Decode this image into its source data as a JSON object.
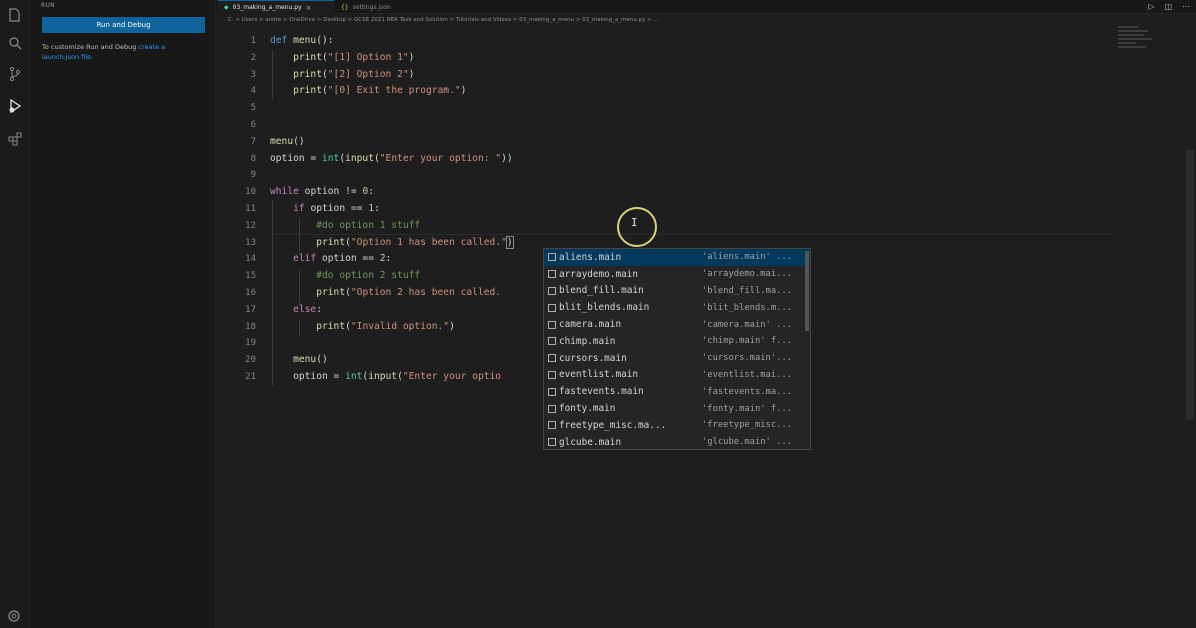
{
  "sidebar": {
    "title": "RUN",
    "run_button": "Run and Debug",
    "hint_text": "To customize Run and Debug",
    "hint_link": "create a launch.json file.",
    "hint_suffix": ""
  },
  "tabs": [
    {
      "label": "03_making_a_menu.py",
      "active": true
    },
    {
      "label": "settings.json",
      "active": false
    }
  ],
  "breadcrumb": "C: > Users > andre > OneDrive > Desktop > GCSE 2021 NEA Task and Solution > Tutorials and Videos > 03_making_a_menu > 03_making_a_menu.py > ...",
  "editor": {
    "line_numbers": [
      "1",
      "2",
      "3",
      "4",
      "5",
      "6",
      "7",
      "8",
      "9",
      "10",
      "11",
      "12",
      "13",
      "14",
      "15",
      "16",
      "17",
      "18",
      "19",
      "20",
      "21"
    ],
    "lines": {
      "l1_kw": "def",
      "l1_fn": "menu",
      "l1_rest": "():",
      "l2_fn": "print",
      "l2_str": "\"[1] Option 1\"",
      "l3_fn": "print",
      "l3_str": "\"[2] Option 2\"",
      "l4_fn": "print",
      "l4_str": "\"[0] Exit the program.\"",
      "l7_fn": "menu",
      "l8_var": "option",
      "l8_bi": "int",
      "l8_fn": "input",
      "l8_str": "\"Enter your option: \"",
      "l10_kw": "while",
      "l10_rest": " option != ",
      "l10_num": "0",
      "l11_kw": "if",
      "l11_rest": " option == ",
      "l11_num": "1",
      "l12_cmt": "#do option 1 stuff",
      "l13_fn": "print",
      "l13_str": "\"Option 1 has been called.\"",
      "l14_kw": "elif",
      "l14_rest": " option == ",
      "l14_num": "2",
      "l15_cmt": "#do option 2 stuff",
      "l16_fn": "print",
      "l16_str": "\"Option 2 has been called.",
      "l17_kw": "else",
      "l18_fn": "print",
      "l18_str": "\"Invalid option.\"",
      "l20_fn": "menu",
      "l21_var": "option",
      "l21_bi": "int",
      "l21_fn": "input",
      "l21_str": "\"Enter your optio"
    }
  },
  "suggestions": [
    {
      "label": "aliens.main",
      "detail": "'aliens.main' ..."
    },
    {
      "label": "arraydemo.main",
      "detail": "'arraydemo.mai..."
    },
    {
      "label": "blend_fill.main",
      "detail": "'blend_fill.ma..."
    },
    {
      "label": "blit_blends.main",
      "detail": "'blit_blends.m..."
    },
    {
      "label": "camera.main",
      "detail": "'camera.main' ..."
    },
    {
      "label": "chimp.main",
      "detail": "'chimp.main' f..."
    },
    {
      "label": "cursors.main",
      "detail": "'cursors.main'..."
    },
    {
      "label": "eventlist.main",
      "detail": "'eventlist.mai..."
    },
    {
      "label": "fastevents.main",
      "detail": "'fastevents.ma..."
    },
    {
      "label": "fonty.main",
      "detail": "'fonty.main' f..."
    },
    {
      "label": "freetype_misc.ma...",
      "detail": "'freetype_misc..."
    },
    {
      "label": "glcube.main",
      "detail": "'glcube.main' ..."
    }
  ],
  "colors": {
    "accent": "#0e639c",
    "selection": "#04395e",
    "cursor_ring": "#d8d27a"
  },
  "icons": [
    "explorer-icon",
    "search-icon",
    "source-control-icon",
    "run-debug-icon",
    "extensions-icon",
    "settings-gear-icon",
    "run-file-icon",
    "split-editor-icon"
  ]
}
